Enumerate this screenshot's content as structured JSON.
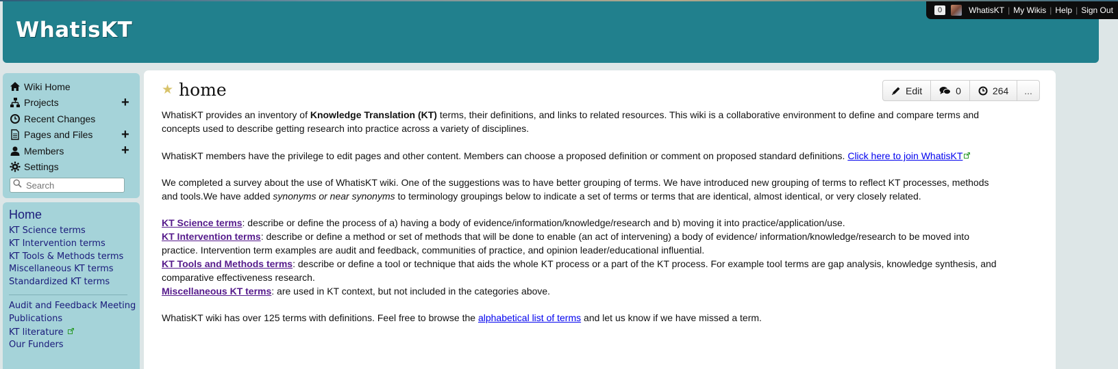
{
  "header": {
    "site_title": "WhatisKT"
  },
  "userbar": {
    "notification_count": "0",
    "username": "WhatisKT",
    "my_wikis": "My Wikis",
    "help": "Help",
    "sign_out": "Sign Out"
  },
  "sidenav": {
    "items": [
      {
        "label": "Wiki Home",
        "icon": "home-icon"
      },
      {
        "label": "Projects",
        "icon": "sitemap-icon",
        "has_add": true
      },
      {
        "label": "Recent Changes",
        "icon": "clock-icon"
      },
      {
        "label": "Pages and Files",
        "icon": "file-icon",
        "has_add": true
      },
      {
        "label": "Members",
        "icon": "user-icon",
        "has_add": true
      },
      {
        "label": "Settings",
        "icon": "gear-icon"
      }
    ],
    "search_placeholder": "Search"
  },
  "sidebar": {
    "home": "Home",
    "links": [
      "KT Science terms",
      "KT Intervention terms",
      "KT Tools & Methods terms",
      "Miscellaneous KT terms",
      "Standardized KT terms"
    ],
    "links2": [
      "Audit and Feedback Meeting",
      "Publications",
      "KT literature",
      "Our Funders"
    ]
  },
  "page": {
    "title": "home",
    "toolbar": {
      "edit": "Edit",
      "comments": "0",
      "revisions": "264",
      "more": "..."
    },
    "p1_a": "WhatisKT provides an inventory of ",
    "p1_bold": "Knowledge Translation (KT)",
    "p1_b": " terms, their definitions, and links to related resources. This wiki is a collaborative environment to define and compare terms and concepts used to describe getting research into practice across a variety of disciplines.",
    "p2_a": "WhatisKT members have the privilege to edit pages and other content. Members can choose a proposed definition or comment on proposed standard definitions. ",
    "p2_link": "Click here to join WhatisKT",
    "p3_a": "We completed a survey about the use of WhatisKT wiki. One of the suggestions was to have better grouping of terms. We have introduced new grouping of terms to reflect KT processes, methods and tools.We have added ",
    "p3_italic": "synonyms or near synonyms",
    "p3_b": " to terminology groupings below to indicate a set of terms or terms that are identical, almost identical, or very closely related.",
    "cat1_link": "KT Science terms",
    "cat1_text": ": describe or define the process of a) having a body of evidence/information/knowledge/research and b) moving it into practice/application/use.",
    "cat2_link": "KT Intervention terms",
    "cat2_text": ": describe or define a method or set of methods that will be done to enable (an act of intervening) a body of evidence/ information/knowledge/research to be moved into practice. Intervention term examples are audit and feedback, communities of practice, and opinion leader/educational influential.",
    "cat3_link": "KT Tools and Methods terms",
    "cat3_text": ": describe or define a tool or technique that aids the whole KT process or a part of the KT process. For example tool terms are gap analysis, knowledge synthesis, and comparative effectiveness research.",
    "cat4_link": "Miscellaneous KT terms",
    "cat4_text": ": are used in KT context, but not included in the categories above.",
    "p5_a": "WhatisKT wiki has over 125 terms with definitions. Feel free to browse the ",
    "p5_link": "alphabetical list of terms",
    "p5_b": " and let us know if we have missed a term."
  },
  "colors": {
    "header_bg": "#21808d",
    "sidebar_bg": "#a5d3d9",
    "page_bg": "#dde6e7",
    "link_visited": "#551a8b",
    "link": "#0000ee"
  }
}
